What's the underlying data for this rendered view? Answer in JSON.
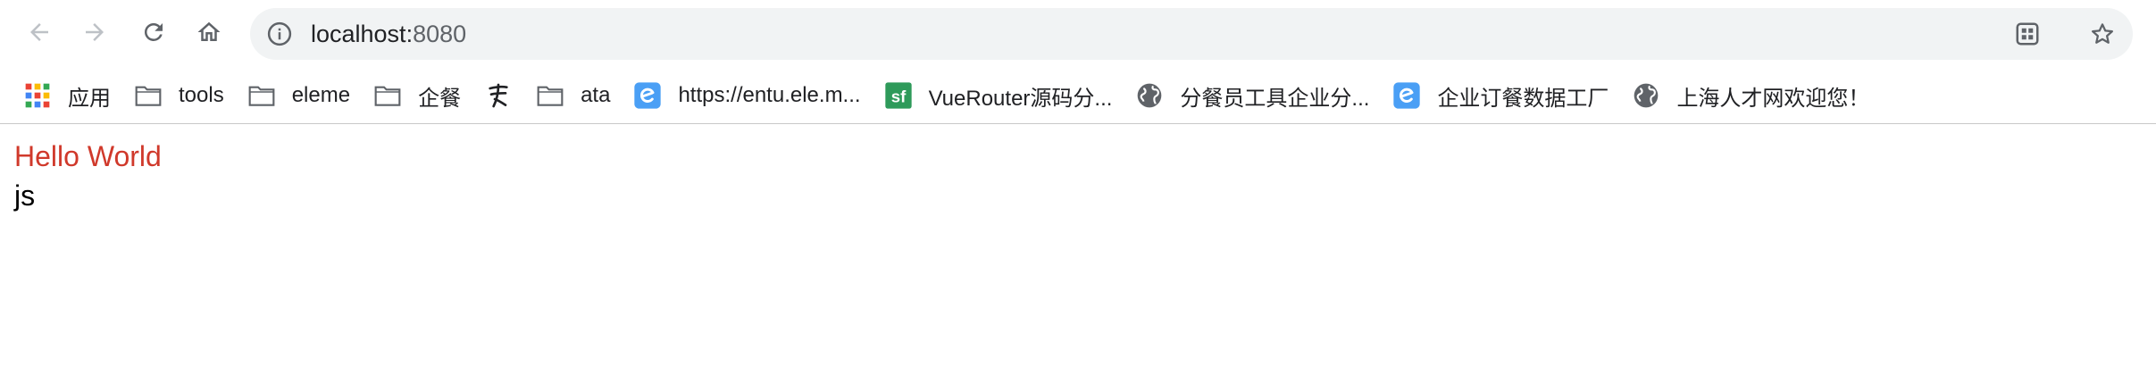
{
  "browser": {
    "address": {
      "host": "localhost:",
      "port": "8080"
    }
  },
  "bookmarks": [
    {
      "label": "应用",
      "icon": "apps-grid-icon"
    },
    {
      "label": "tools",
      "icon": "folder-icon"
    },
    {
      "label": "eleme",
      "icon": "folder-icon"
    },
    {
      "label": "企餐",
      "icon": "folder-icon"
    },
    {
      "label": "",
      "icon": "calligraphy-icon"
    },
    {
      "label": "ata",
      "icon": "folder-icon"
    },
    {
      "label": "https://entu.ele.m...",
      "icon": "eleme-e-icon"
    },
    {
      "label": "VueRouter源码分...",
      "icon": "sf-icon"
    },
    {
      "label": "分餐员工具企业分...",
      "icon": "globe-icon"
    },
    {
      "label": "企业订餐数据工厂",
      "icon": "eleme-e-icon"
    },
    {
      "label": "上海人才网欢迎您！",
      "icon": "globe-icon"
    }
  ],
  "page": {
    "heading": "Hello World",
    "text": "js"
  },
  "colors": {
    "heading": "#d0392b",
    "omnibox_bg": "#f1f3f4",
    "eleme_blue": "#4a9ff5",
    "sf_green": "#2e9a5a"
  }
}
